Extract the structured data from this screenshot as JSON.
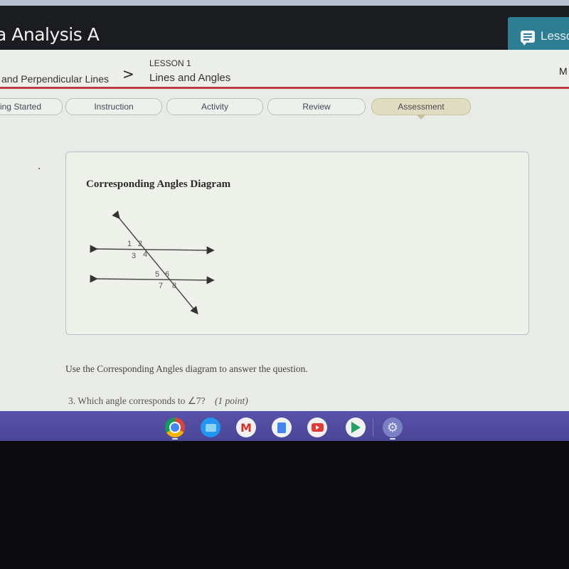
{
  "header": {
    "course_title": "a Analysis A",
    "lesson_button_label": "Lesso",
    "lesson_button_icon": "lesson-notes-icon"
  },
  "breadcrumb": {
    "previous": "and Perpendicular Lines",
    "separator": ">",
    "lesson_number": "LESSON 1",
    "lesson_name": "Lines and Angles",
    "right_truncated": "M"
  },
  "tabs": [
    {
      "label": "ing Started",
      "active": false
    },
    {
      "label": "Instruction",
      "active": false
    },
    {
      "label": "Activity",
      "active": false
    },
    {
      "label": "Review",
      "active": false
    },
    {
      "label": "Assessment",
      "active": true
    }
  ],
  "card": {
    "title": "Corresponding Angles Diagram",
    "angle_labels": [
      "1",
      "2",
      "3",
      "4",
      "5",
      "6",
      "7",
      "8"
    ]
  },
  "content": {
    "instruction": "Use the Corresponding Angles diagram to answer the question.",
    "question_number": "3.",
    "question_text": "Which angle corresponds to ∠7?",
    "question_points": "(1 point)"
  },
  "shelf": {
    "apps": [
      {
        "name": "Chrome",
        "icon": "chrome-icon"
      },
      {
        "name": "Files",
        "icon": "files-icon"
      },
      {
        "name": "Gmail",
        "icon": "gmail-icon"
      },
      {
        "name": "Docs",
        "icon": "docs-icon"
      },
      {
        "name": "YouTube",
        "icon": "youtube-icon"
      },
      {
        "name": "Play Store",
        "icon": "play-store-icon"
      },
      {
        "name": "Settings",
        "icon": "settings-icon"
      }
    ]
  }
}
